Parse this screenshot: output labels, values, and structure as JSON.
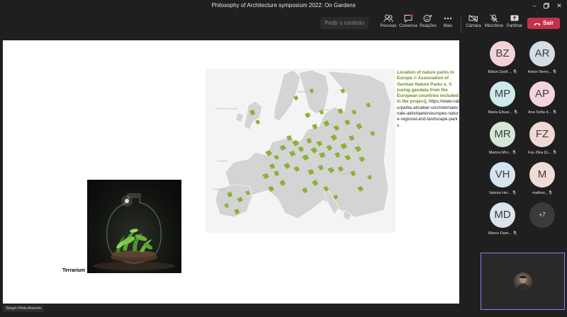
{
  "window": {
    "title": "Philosophy of Architecture symposium 2022: On Gardens"
  },
  "toolbar": {
    "control_label": "Pedir o controlo",
    "people_label": "Pessoas",
    "chat_label": "Conversa",
    "reactions_label": "Reações",
    "more_label": "Mais",
    "camera_label": "Câmara",
    "mic_label": "Microfone",
    "share_label": "Partilhar",
    "leave_label": "Sair",
    "leave_color": "#c4314b"
  },
  "slide": {
    "terrarium_label": "Terrarium",
    "caption_highlight": "Location of nature parks in Europe © Association of German Nature Parks e. V. (using geodata from the European countries included in the project),",
    "caption_url": "https://www.naturparke.at/ueber-uns/internationale-aktivitaeten/europes-nature-regional-and-landscape-parks"
  },
  "presenter": {
    "name": "Sérgio Pinto Amorim"
  },
  "participants": [
    {
      "initials": "BZ",
      "name": "Bátori Zsolt ...",
      "color": "#f3d3d7"
    },
    {
      "initials": "AR",
      "name": "Anton Renn...",
      "color": "#d4dde3"
    },
    {
      "initials": "MP",
      "name": "Maria Eduar...",
      "color": "#cde9ec"
    },
    {
      "initials": "AP",
      "name": "Ana Sofia d...",
      "color": "#f6d4dd"
    },
    {
      "initials": "MR",
      "name": "Marina Moi...",
      "color": "#d6e6d6"
    },
    {
      "initials": "FZ",
      "name": "Fay Zika (G...",
      "color": "#f0d9d3"
    },
    {
      "initials": "VH",
      "name": "Valeria Her...",
      "color": "#d6e4f0"
    },
    {
      "initials": "M",
      "name": "matkon_",
      "color": "#efdcd6"
    },
    {
      "initials": "MD",
      "name": "Marco Dam...",
      "color": "#dbe3ec"
    }
  ],
  "more_participants": "+7"
}
